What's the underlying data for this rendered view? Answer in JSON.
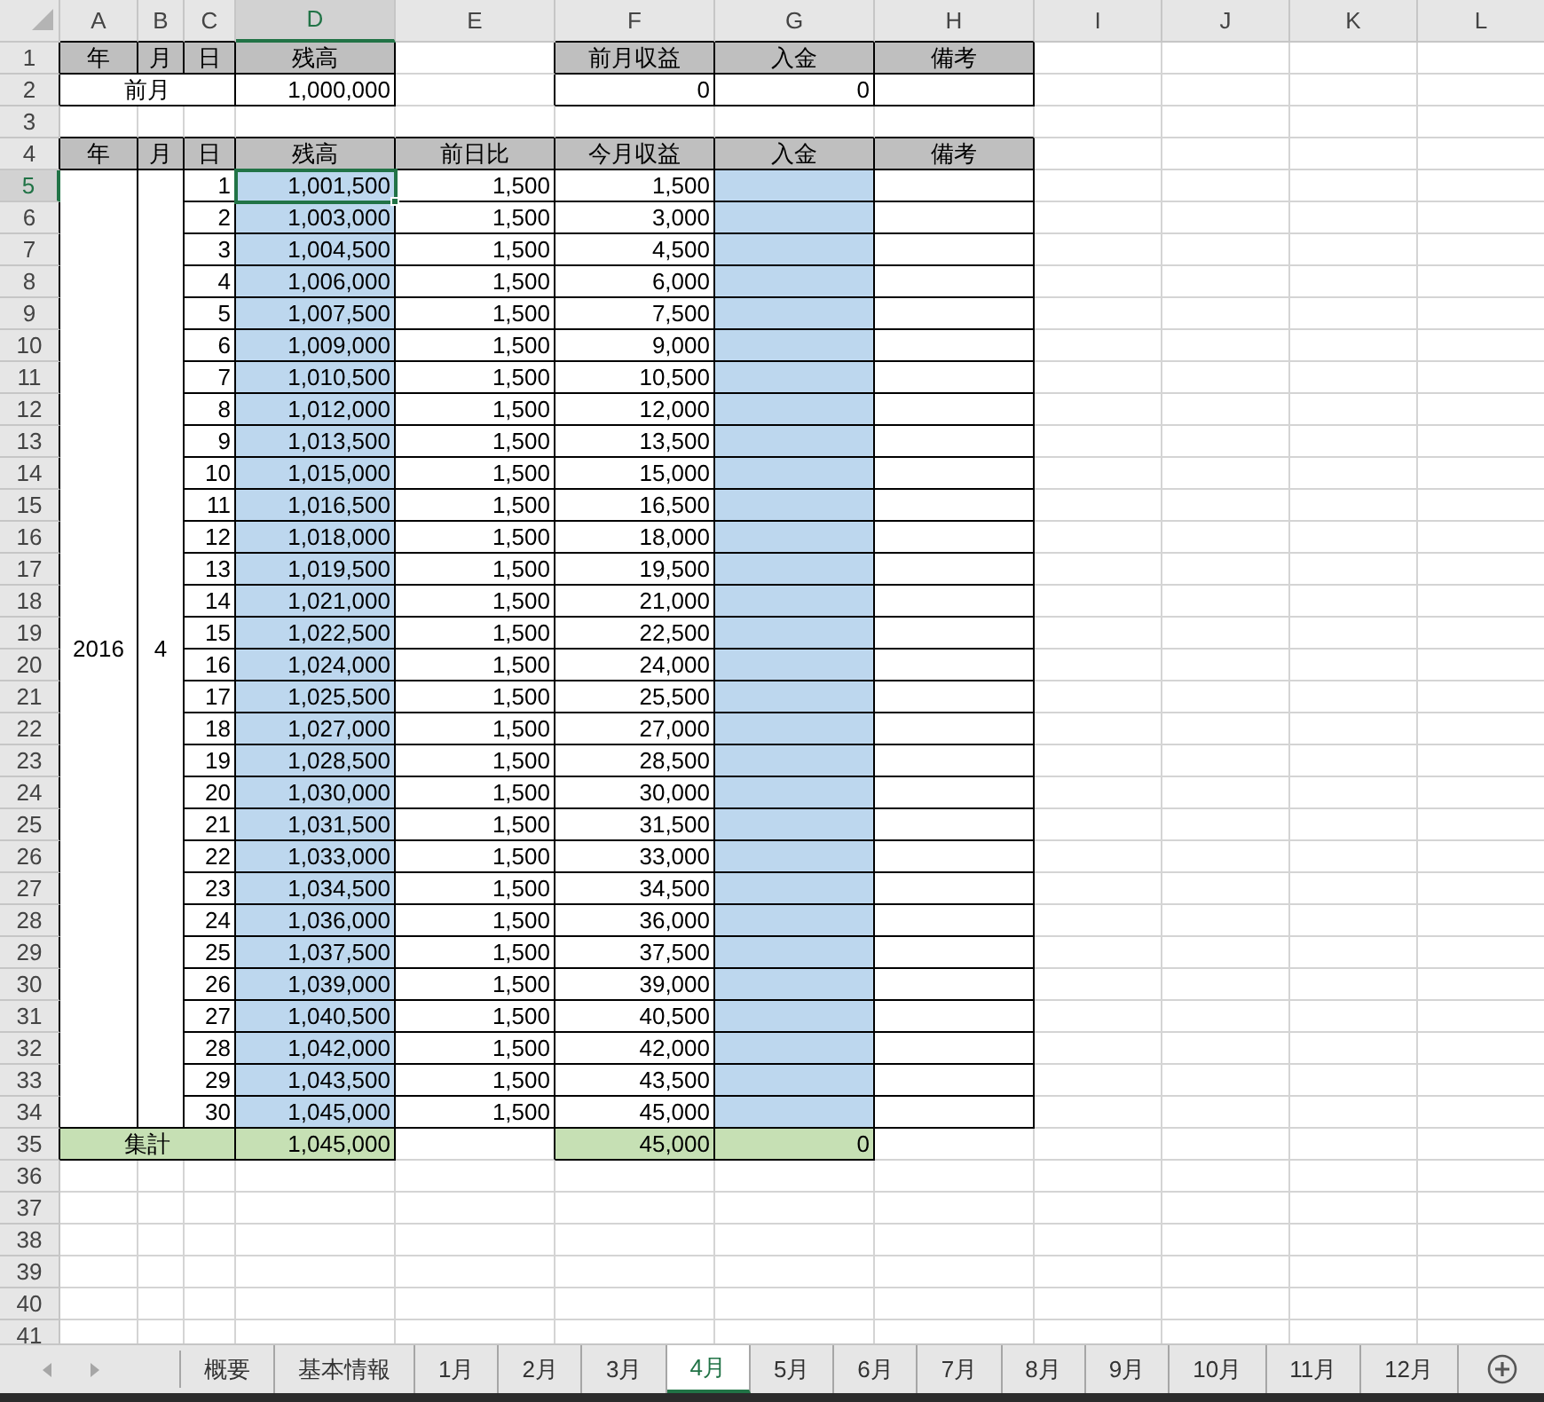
{
  "column_headers": [
    {
      "label": "A",
      "selected": false
    },
    {
      "label": "B",
      "selected": false
    },
    {
      "label": "C",
      "selected": false
    },
    {
      "label": "D",
      "selected": true
    },
    {
      "label": "E",
      "selected": false
    },
    {
      "label": "F",
      "selected": false
    },
    {
      "label": "G",
      "selected": false
    },
    {
      "label": "H",
      "selected": false
    },
    {
      "label": "I",
      "selected": false
    },
    {
      "label": "J",
      "selected": false
    },
    {
      "label": "K",
      "selected": false
    },
    {
      "label": "L",
      "selected": false
    }
  ],
  "row_headers": [
    {
      "label": "1",
      "selected": false
    },
    {
      "label": "2",
      "selected": false
    },
    {
      "label": "3",
      "selected": false
    },
    {
      "label": "4",
      "selected": false
    },
    {
      "label": "5",
      "selected": true
    },
    {
      "label": "6",
      "selected": false
    },
    {
      "label": "7",
      "selected": false
    },
    {
      "label": "8",
      "selected": false
    },
    {
      "label": "9",
      "selected": false
    },
    {
      "label": "10",
      "selected": false
    },
    {
      "label": "11",
      "selected": false
    },
    {
      "label": "12",
      "selected": false
    },
    {
      "label": "13",
      "selected": false
    },
    {
      "label": "14",
      "selected": false
    },
    {
      "label": "15",
      "selected": false
    },
    {
      "label": "16",
      "selected": false
    },
    {
      "label": "17",
      "selected": false
    },
    {
      "label": "18",
      "selected": false
    },
    {
      "label": "19",
      "selected": false
    },
    {
      "label": "20",
      "selected": false
    },
    {
      "label": "21",
      "selected": false
    },
    {
      "label": "22",
      "selected": false
    },
    {
      "label": "23",
      "selected": false
    },
    {
      "label": "24",
      "selected": false
    },
    {
      "label": "25",
      "selected": false
    },
    {
      "label": "26",
      "selected": false
    },
    {
      "label": "27",
      "selected": false
    },
    {
      "label": "28",
      "selected": false
    },
    {
      "label": "29",
      "selected": false
    },
    {
      "label": "30",
      "selected": false
    },
    {
      "label": "31",
      "selected": false
    },
    {
      "label": "32",
      "selected": false
    },
    {
      "label": "33",
      "selected": false
    },
    {
      "label": "34",
      "selected": false
    },
    {
      "label": "35",
      "selected": false
    },
    {
      "label": "36",
      "selected": false
    },
    {
      "label": "37",
      "selected": false
    },
    {
      "label": "38",
      "selected": false
    },
    {
      "label": "39",
      "selected": false
    },
    {
      "label": "40",
      "selected": false
    },
    {
      "label": "41",
      "selected": false
    }
  ],
  "summary_table": {
    "header": [
      "年",
      "月",
      "日",
      "残高",
      "前月収益",
      "入金",
      "備考"
    ],
    "previous_label": "前月",
    "previous_balance": "1,000,000",
    "previous_income": "0",
    "deposit": "0"
  },
  "daily_table": {
    "header": [
      "年",
      "月",
      "日",
      "残高",
      "前日比",
      "今月収益",
      "入金",
      "備考"
    ],
    "year": "2016",
    "month": "4",
    "rows": [
      {
        "day": "1",
        "balance": "1,001,500",
        "diff": "1,500",
        "income": "1,500",
        "selected": true
      },
      {
        "day": "2",
        "balance": "1,003,000",
        "diff": "1,500",
        "income": "3,000",
        "selected": false
      },
      {
        "day": "3",
        "balance": "1,004,500",
        "diff": "1,500",
        "income": "4,500",
        "selected": false
      },
      {
        "day": "4",
        "balance": "1,006,000",
        "diff": "1,500",
        "income": "6,000",
        "selected": false
      },
      {
        "day": "5",
        "balance": "1,007,500",
        "diff": "1,500",
        "income": "7,500",
        "selected": false
      },
      {
        "day": "6",
        "balance": "1,009,000",
        "diff": "1,500",
        "income": "9,000",
        "selected": false
      },
      {
        "day": "7",
        "balance": "1,010,500",
        "diff": "1,500",
        "income": "10,500",
        "selected": false
      },
      {
        "day": "8",
        "balance": "1,012,000",
        "diff": "1,500",
        "income": "12,000",
        "selected": false
      },
      {
        "day": "9",
        "balance": "1,013,500",
        "diff": "1,500",
        "income": "13,500",
        "selected": false
      },
      {
        "day": "10",
        "balance": "1,015,000",
        "diff": "1,500",
        "income": "15,000",
        "selected": false
      },
      {
        "day": "11",
        "balance": "1,016,500",
        "diff": "1,500",
        "income": "16,500",
        "selected": false
      },
      {
        "day": "12",
        "balance": "1,018,000",
        "diff": "1,500",
        "income": "18,000",
        "selected": false
      },
      {
        "day": "13",
        "balance": "1,019,500",
        "diff": "1,500",
        "income": "19,500",
        "selected": false
      },
      {
        "day": "14",
        "balance": "1,021,000",
        "diff": "1,500",
        "income": "21,000",
        "selected": false
      },
      {
        "day": "15",
        "balance": "1,022,500",
        "diff": "1,500",
        "income": "22,500",
        "selected": false
      },
      {
        "day": "16",
        "balance": "1,024,000",
        "diff": "1,500",
        "income": "24,000",
        "selected": false
      },
      {
        "day": "17",
        "balance": "1,025,500",
        "diff": "1,500",
        "income": "25,500",
        "selected": false
      },
      {
        "day": "18",
        "balance": "1,027,000",
        "diff": "1,500",
        "income": "27,000",
        "selected": false
      },
      {
        "day": "19",
        "balance": "1,028,500",
        "diff": "1,500",
        "income": "28,500",
        "selected": false
      },
      {
        "day": "20",
        "balance": "1,030,000",
        "diff": "1,500",
        "income": "30,000",
        "selected": false
      },
      {
        "day": "21",
        "balance": "1,031,500",
        "diff": "1,500",
        "income": "31,500",
        "selected": false
      },
      {
        "day": "22",
        "balance": "1,033,000",
        "diff": "1,500",
        "income": "33,000",
        "selected": false
      },
      {
        "day": "23",
        "balance": "1,034,500",
        "diff": "1,500",
        "income": "34,500",
        "selected": false
      },
      {
        "day": "24",
        "balance": "1,036,000",
        "diff": "1,500",
        "income": "36,000",
        "selected": false
      },
      {
        "day": "25",
        "balance": "1,037,500",
        "diff": "1,500",
        "income": "37,500",
        "selected": false
      },
      {
        "day": "26",
        "balance": "1,039,000",
        "diff": "1,500",
        "income": "39,000",
        "selected": false
      },
      {
        "day": "27",
        "balance": "1,040,500",
        "diff": "1,500",
        "income": "40,500",
        "selected": false
      },
      {
        "day": "28",
        "balance": "1,042,000",
        "diff": "1,500",
        "income": "42,000",
        "selected": false
      },
      {
        "day": "29",
        "balance": "1,043,500",
        "diff": "1,500",
        "income": "43,500",
        "selected": false
      },
      {
        "day": "30",
        "balance": "1,045,000",
        "diff": "1,500",
        "income": "45,000",
        "selected": false
      }
    ],
    "total": {
      "label": "集計",
      "balance": "1,045,000",
      "income": "45,000",
      "deposit": "0"
    }
  },
  "sheet_tabs": [
    {
      "label": "概要",
      "selected": false
    },
    {
      "label": "基本情報",
      "selected": false
    },
    {
      "label": "1月",
      "selected": false
    },
    {
      "label": "2月",
      "selected": false
    },
    {
      "label": "3月",
      "selected": false
    },
    {
      "label": "4月",
      "selected": true
    },
    {
      "label": "5月",
      "selected": false
    },
    {
      "label": "6月",
      "selected": false
    },
    {
      "label": "7月",
      "selected": false
    },
    {
      "label": "8月",
      "selected": false
    },
    {
      "label": "9月",
      "selected": false
    },
    {
      "label": "10月",
      "selected": false
    },
    {
      "label": "11月",
      "selected": false
    },
    {
      "label": "12月",
      "selected": false
    }
  ]
}
